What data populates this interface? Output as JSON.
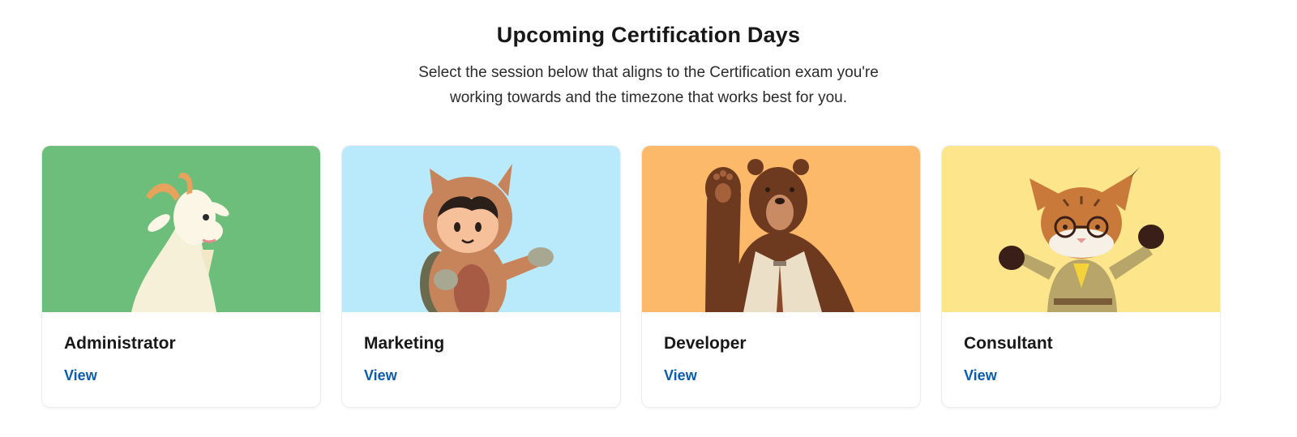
{
  "header": {
    "title": "Upcoming Certification Days",
    "subtitle_line1": "Select the session below that aligns to the Certification exam you're",
    "subtitle_line2": "working towards and the timezone that works best for you."
  },
  "cards": [
    {
      "name": "Administrator",
      "link": "View",
      "bg": "#6ebe7b",
      "mascot": "goat-illustration"
    },
    {
      "name": "Marketing",
      "link": "View",
      "bg": "#b9eafb",
      "mascot": "astro-cat-illustration"
    },
    {
      "name": "Developer",
      "link": "View",
      "bg": "#fdb96a",
      "mascot": "bear-illustration"
    },
    {
      "name": "Consultant",
      "link": "View",
      "bg": "#fde58b",
      "mascot": "lynx-illustration"
    }
  ],
  "colors": {
    "link": "#0b5cab",
    "text": "#181818"
  }
}
